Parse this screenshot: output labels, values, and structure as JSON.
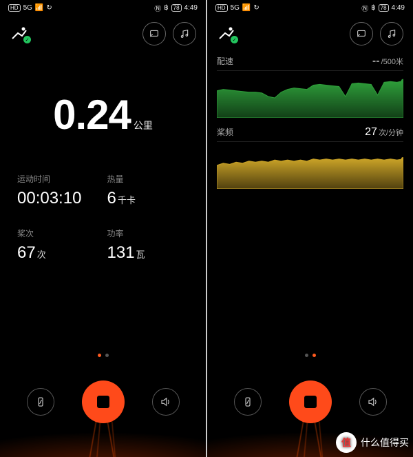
{
  "status": {
    "time": "4:49",
    "battery": "78",
    "hd": "HD",
    "net": "5G"
  },
  "topIcons": {
    "cast": "cast-icon",
    "music": "music-icon"
  },
  "left": {
    "mainValue": "0.24",
    "mainUnit": "公里",
    "cells": [
      {
        "label": "运动时间",
        "value": "00:03:10",
        "unit": ""
      },
      {
        "label": "热量",
        "value": "6",
        "unit": "千卡"
      },
      {
        "label": "桨次",
        "value": "67",
        "unit": "次"
      },
      {
        "label": "功率",
        "value": "131",
        "unit": "瓦"
      }
    ],
    "pageDots": {
      "count": 2,
      "active": 0
    }
  },
  "right": {
    "pace": {
      "label": "配速",
      "value": "--",
      "unit": "/500米"
    },
    "cadence": {
      "label": "桨频",
      "value": "27",
      "unit": "次/分钟"
    },
    "pageDots": {
      "count": 2,
      "active": 1
    }
  },
  "chart_data": [
    {
      "type": "area",
      "title": "配速",
      "x": [
        0,
        1,
        2,
        3,
        4,
        5,
        6,
        7,
        8,
        9,
        10,
        11,
        12,
        13,
        14,
        15,
        16,
        17,
        18,
        19,
        20,
        21,
        22,
        23,
        24,
        25,
        26,
        27,
        28,
        29
      ],
      "values": [
        38,
        40,
        39,
        38,
        37,
        36,
        36,
        35,
        30,
        28,
        36,
        40,
        42,
        41,
        40,
        46,
        47,
        46,
        45,
        44,
        30,
        48,
        49,
        48,
        47,
        32,
        50,
        51,
        50,
        52
      ],
      "ylim": [
        0,
        60
      ],
      "color": "#2e9e3a"
    },
    {
      "type": "area",
      "title": "桨频",
      "x": [
        0,
        1,
        2,
        3,
        4,
        5,
        6,
        7,
        8,
        9,
        10,
        11,
        12,
        13,
        14,
        15,
        16,
        17,
        18,
        19,
        20,
        21,
        22,
        23,
        24,
        25,
        26,
        27,
        28,
        29
      ],
      "values": [
        22,
        24,
        23,
        25,
        24,
        26,
        25,
        26,
        25,
        27,
        26,
        27,
        26,
        27,
        26,
        28,
        27,
        28,
        27,
        28,
        27,
        28,
        27,
        28,
        27,
        28,
        27,
        28,
        27,
        28
      ],
      "ylim": [
        0,
        40
      ],
      "color": "#c9a227"
    }
  ],
  "watermark": "什么值得买"
}
